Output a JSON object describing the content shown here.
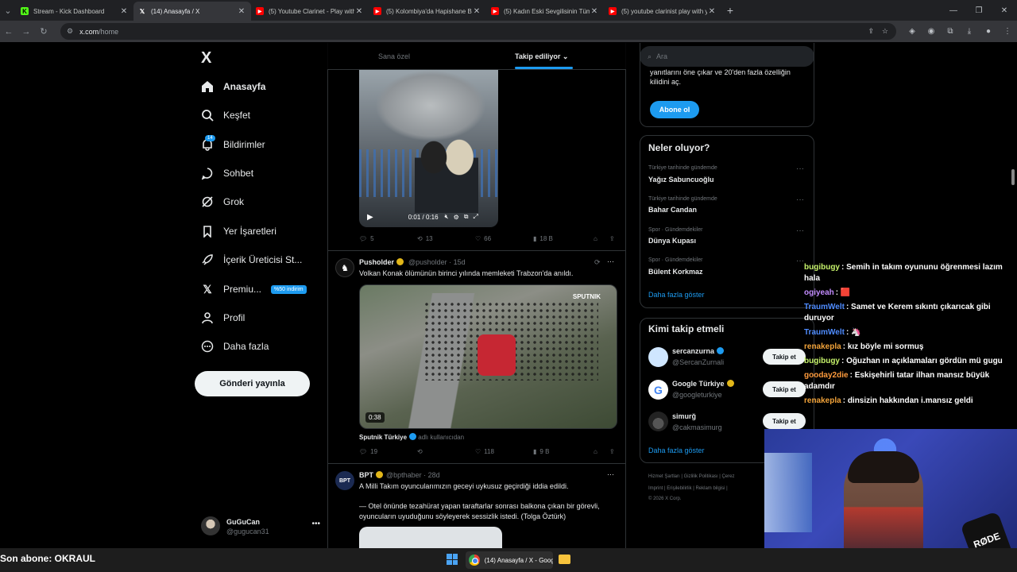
{
  "browser": {
    "tabs": [
      {
        "title": "Stream - Kick Dashboard",
        "icon": "kick-icon",
        "active": false
      },
      {
        "title": "(14) Anasayfa / X",
        "icon": "x-icon",
        "active": true
      },
      {
        "title": "(5) Youtube Clarinet - Play with",
        "icon": "youtube-icon",
        "active": false
      },
      {
        "title": "(5) Kolombiya'da Hapishane Ba",
        "icon": "youtube-icon",
        "active": false
      },
      {
        "title": "(5) Kadın Eski Sevgilisinin Tüm",
        "icon": "youtube-icon",
        "active": false
      },
      {
        "title": "(5) youtube clarinist play with y",
        "icon": "youtube-icon",
        "active": false
      }
    ],
    "url_host": "x.com",
    "url_path": "/home"
  },
  "sidebar": {
    "logo": "X",
    "items": [
      {
        "label": "Anasayfa",
        "icon": "home-icon"
      },
      {
        "label": "Keşfet",
        "icon": "search-icon"
      },
      {
        "label": "Bildirimler",
        "icon": "bell-icon",
        "badge": "14"
      },
      {
        "label": "Sohbet",
        "icon": "chat-icon"
      },
      {
        "label": "Grok",
        "icon": "grok-icon"
      },
      {
        "label": "Yer İşaretleri",
        "icon": "bookmark-icon"
      },
      {
        "label": "İçerik Üreticisi St...",
        "icon": "rocket-icon"
      },
      {
        "label": "Premiu...",
        "icon": "x-premium-icon",
        "promo": "%50 indirim"
      },
      {
        "label": "Profil",
        "icon": "person-icon"
      },
      {
        "label": "Daha fazla",
        "icon": "more-circle-icon"
      }
    ],
    "post_button": "Gönderi yayınla",
    "account": {
      "name": "GuGuCan",
      "handle": "@gugucan31"
    }
  },
  "feed": {
    "tabs": [
      {
        "label": "Sana özel"
      },
      {
        "label": "Takip ediliyor"
      }
    ],
    "posts": [
      {
        "video": {
          "time": "0:01 / 0:16"
        },
        "stats": {
          "replies": "5",
          "reposts": "13",
          "likes": "66",
          "views": "18 B"
        }
      },
      {
        "name": "Pusholder",
        "handle": "@pusholder",
        "age": "15d",
        "text": "Volkan Konak ölümünün birinci yılında memleketi Trabzon'da anıldı.",
        "media": {
          "duration": "0:38",
          "watermark": "SPUTNIK"
        },
        "source_name": "Sputnik Türkiye",
        "source_note": "adlı kullanıcıdan",
        "stats": {
          "replies": "19",
          "reposts": "",
          "likes": "118",
          "views": "9 B"
        }
      },
      {
        "name": "BPT",
        "handle": "@bpthaber",
        "age": "28d",
        "text": "A Milli Takım oyuncularımızın geceyi uykusuz geçirdiği iddia edildi.",
        "text2": "— Otel önünde tezahürat yapan taraftarlar sonrası balkona çıkan bir görevli, oyuncuların uyuduğunu söyleyerek sessizlik istedi. (Tolga Öztürk)"
      }
    ]
  },
  "right": {
    "search_placeholder": "Ara",
    "premium": {
      "text": "yanıtlarını öne çıkar ve 20'den fazla özelliğin kilidini aç.",
      "button": "Abone ol"
    },
    "trends_title": "Neler oluyor?",
    "trends": [
      {
        "category": "Türkiye tarihinde gündemde",
        "name": "Yağız Sabuncuoğlu"
      },
      {
        "category": "Türkiye tarihinde gündemde",
        "name": "Bahar Candan"
      },
      {
        "category": "Spor · Gündemdekiler",
        "name": "Dünya Kupası"
      },
      {
        "category": "Spor · Gündemdekiler",
        "name": "Bülent Korkmaz"
      }
    ],
    "show_more": "Daha fazla göster",
    "who_title": "Kimi takip etmeli",
    "who": [
      {
        "name": "sercanzurna",
        "handle": "@SercanZurnali",
        "button": "Takip et"
      },
      {
        "name": "Google Türkiye",
        "handle": "@googleturkiye",
        "button": "Takip et"
      },
      {
        "name": "simurğ",
        "handle": "@cakmasimurg",
        "button": "Takip et"
      }
    ],
    "footer_line1": "Hizmet Şartları | Gizlilik Politikası | Çerez",
    "footer_line2": "Imprint | Erişilebilirlik | Reklam bilgisi |",
    "footer_line3": "© 2026 X Corp."
  },
  "chat": [
    {
      "user": "bugibugy",
      "color": "#c6f26b",
      "text": "Semih in takım oyununu öğrenmesi lazım hala"
    },
    {
      "user": "ogiyeah",
      "color": "#c38cff",
      "text": "🟥"
    },
    {
      "user": "TraumWelt",
      "color": "#4f8cff",
      "text": "Samet ve Kerem sıkıntı çıkarıcak gibi duruyor"
    },
    {
      "user": "TraumWelt",
      "color": "#4f8cff",
      "text": "🦄"
    },
    {
      "user": "renakepla",
      "color": "#f2a33a",
      "text": "kız böyle mi sormuş"
    },
    {
      "user": "bugibugy",
      "color": "#c6f26b",
      "text": "Oğuzhan ın açıklamaları gördün mü gugu"
    },
    {
      "user": "gooday2die",
      "color": "#ff9b3d",
      "text": "Eskişehirli tatar ilhan mansız büyük adamdır"
    },
    {
      "user": "renakepla",
      "color": "#f2a33a",
      "text": "dinsizin hakkından i.mansız geldi"
    }
  ],
  "stream": {
    "last_sub": "Son abone: OKRAUL",
    "mic_label": "RØDE"
  },
  "taskbar": {
    "app_label": "(14) Anasayfa / X - Goog"
  }
}
